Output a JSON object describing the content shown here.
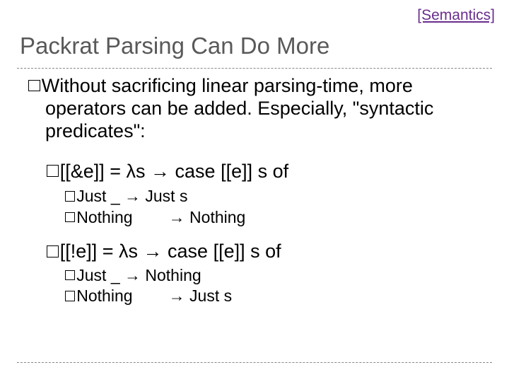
{
  "topLink": "[Semantics]",
  "title": "Packrat Parsing Can Do More",
  "intro": "Without sacrificing linear parsing-time, more operators can be added. Especially, \"syntactic predicates\":",
  "block1": {
    "head": "[[&e]] = λs → case [[e]] s of",
    "l1": "Just _ → Just s",
    "l2a": "Nothing",
    "l2b": "→ Nothing"
  },
  "block2": {
    "head": "[[!e]] = λs → case [[e]] s of",
    "l1": "Just _ → Nothing",
    "l2a": "Nothing",
    "l2b": "→ Just s"
  }
}
